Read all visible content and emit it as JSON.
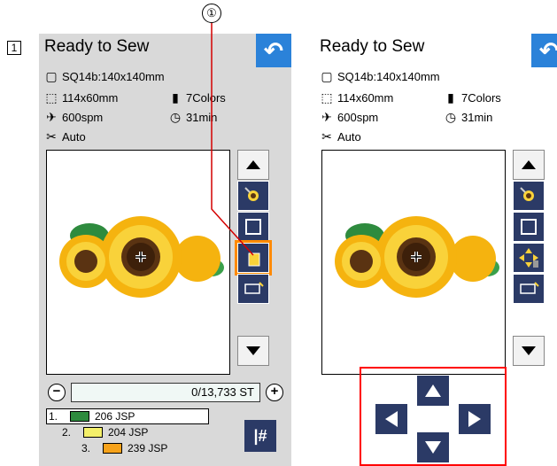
{
  "step_number": "1",
  "callout_number": "①",
  "left_panel": {
    "title": "Ready to Sew",
    "hoop": "SQ14b:140x140mm",
    "size": "114x60mm",
    "colors": "7Colors",
    "speed": "600spm",
    "time": "31min",
    "thread_cut": "Auto",
    "stitch_counter": "0/13,733 ST",
    "minus_label": "−",
    "plus_label": "+",
    "color_list": [
      {
        "index": "1.",
        "swatch": "#2e8b3e",
        "code": "206 JSP"
      },
      {
        "index": "2.",
        "swatch": "#f4f06a",
        "code": "204 JSP"
      },
      {
        "index": "3.",
        "swatch": "#f6a21a",
        "code": "239 JSP"
      }
    ],
    "jump_label": "|#"
  },
  "right_panel": {
    "title": "Ready to Sew",
    "hoop": "SQ14b:140x140mm",
    "size": "114x60mm",
    "colors": "7Colors",
    "speed": "600spm",
    "time": "31min",
    "thread_cut": "Auto"
  },
  "accent_colors": {
    "back_button": "#2b82d9",
    "nav_button": "#2b3a66",
    "highlight": "#ff0000"
  }
}
